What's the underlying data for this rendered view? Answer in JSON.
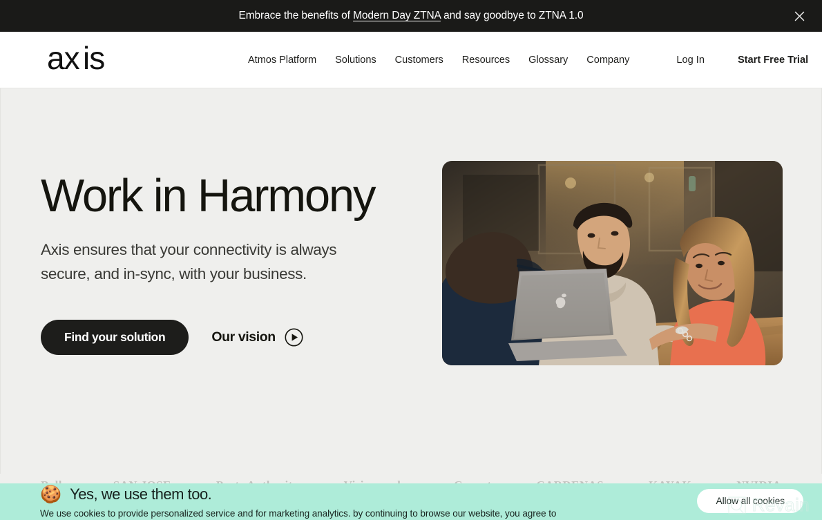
{
  "announcement": {
    "text_before": "Embrace the benefits of ",
    "link_text": "Modern Day ZTNA",
    "text_after": " and say goodbye to ZTNA 1.0",
    "close_icon": "close-icon",
    "background": "#1a1a18",
    "text_color": "#ffffff"
  },
  "header": {
    "logo_text": "axis",
    "nav": [
      {
        "label": "Atmos Platform"
      },
      {
        "label": "Solutions"
      },
      {
        "label": "Customers"
      },
      {
        "label": "Resources"
      },
      {
        "label": "Glossary"
      },
      {
        "label": "Company"
      }
    ],
    "login_label": "Log In",
    "trial_label": "Start Free Trial",
    "background": "#ffffff"
  },
  "hero": {
    "title": "Work in Harmony",
    "subtitle": "Axis ensures that your connectivity is always secure, and in-sync, with your business.",
    "primary_cta": "Find your solution",
    "secondary_cta": "Our vision",
    "play_icon": "play-circle-icon",
    "background": "#efefed",
    "image_alt": "Three colleagues collaborating around a laptop at a wooden table"
  },
  "logos": [
    {
      "name": "Bally"
    },
    {
      "name": "SAN JOSE"
    },
    {
      "name": "Ports Authority"
    },
    {
      "name": "Visionworks"
    },
    {
      "name": "Copart"
    },
    {
      "name": "CARDENAS"
    },
    {
      "name": "KAYAK"
    },
    {
      "name": "NVIDIA"
    }
  ],
  "cookie_banner": {
    "emoji": "🍪",
    "icon_name": "cookie-icon",
    "title": "Yes, we use them too.",
    "body": "We use cookies to provide personalized service and for marketing analytics. by continuing to browse our website, you agree to",
    "allow_label": "Allow all cookies",
    "background": "#aeecd9"
  },
  "watermark": {
    "text": "Revain"
  }
}
